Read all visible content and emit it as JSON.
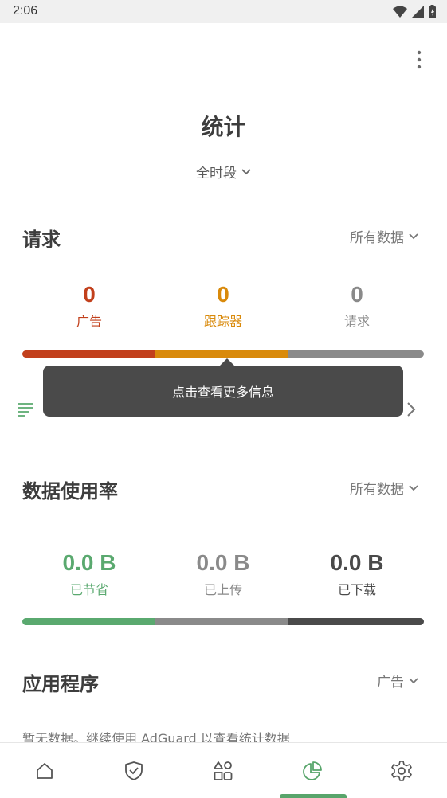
{
  "status_bar": {
    "time": "2:06"
  },
  "header": {
    "title": "统计",
    "period": "全时段"
  },
  "requests": {
    "title": "请求",
    "filter": "所有数据",
    "stats": [
      {
        "value": "0",
        "label": "广告",
        "color": "#c2401c"
      },
      {
        "value": "0",
        "label": "跟踪器",
        "color": "#d98a0b"
      },
      {
        "value": "0",
        "label": "请求",
        "color": "#8a8a8a"
      }
    ],
    "tooltip": "点击查看更多信息"
  },
  "data_usage": {
    "title": "数据使用率",
    "filter": "所有数据",
    "stats": [
      {
        "value": "0.0 B",
        "label": "已节省",
        "color": "#5aa96f"
      },
      {
        "value": "0.0 B",
        "label": "已上传",
        "color": "#8a8a8a"
      },
      {
        "value": "0.0 B",
        "label": "已下载",
        "color": "#4a4a4a"
      }
    ]
  },
  "apps": {
    "title": "应用程序",
    "filter": "广告",
    "empty_text": "暂无数据。继续使用 AdGuard 以查看统计数据"
  },
  "bottom_nav": {
    "items": [
      "home-icon",
      "shield-icon",
      "apps-icon",
      "statistics-icon",
      "settings-icon"
    ],
    "active_index": 3
  }
}
